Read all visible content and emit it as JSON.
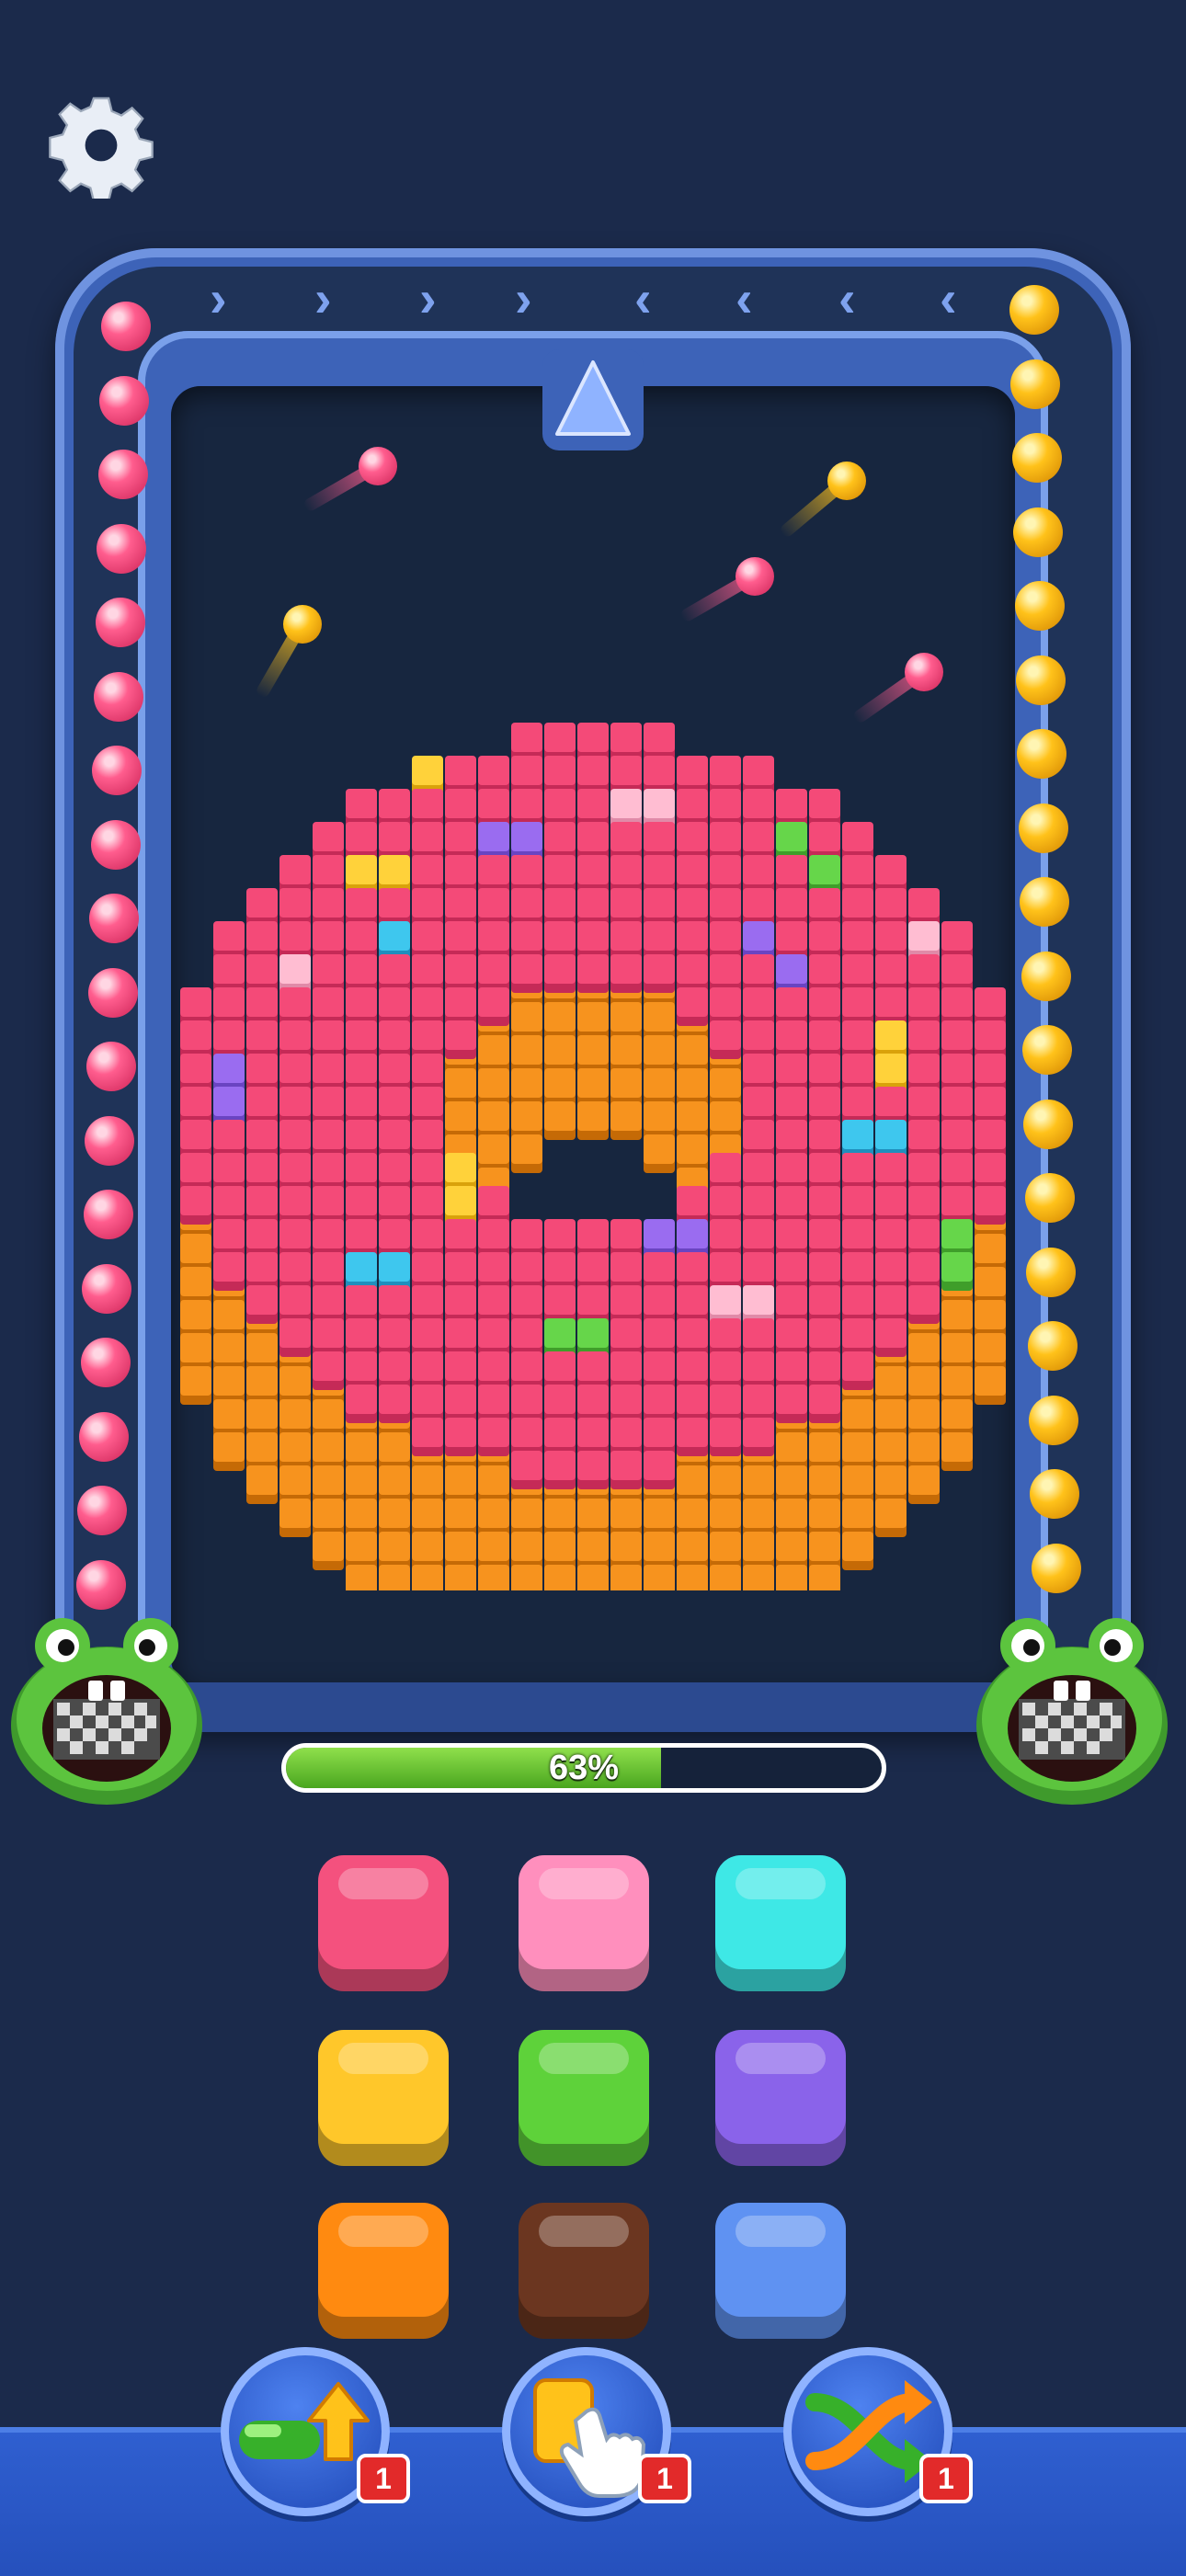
{
  "progress": {
    "value": 63,
    "label": "63%"
  },
  "colors": {
    "background": "#1b2a4b",
    "board_frame": "#3d63b8",
    "ball_pink": "#ff5d8e",
    "ball_gold": "#ffc21a",
    "donut_icing": "#f44a78",
    "donut_dough": "#f7931e",
    "progress_fill": "#6cc63a"
  },
  "conveyor": {
    "left_queue_color": "pink",
    "right_queue_color": "gold",
    "left_count": 18,
    "right_count": 18,
    "launcher_icon": "up-triangle-icon"
  },
  "flying_balls": [
    "pink",
    "gold",
    "pink",
    "gold",
    "pink"
  ],
  "picture": {
    "subject": "donut",
    "colors": [
      "pink",
      "orange",
      "yellow",
      "purple",
      "green",
      "cyan",
      "light-pink"
    ]
  },
  "color_tiles": [
    {
      "name": "pink",
      "color": "#f4517e"
    },
    {
      "name": "light-pink",
      "color": "#ff8fbd"
    },
    {
      "name": "cyan",
      "color": "#3ee8e6"
    },
    {
      "name": "yellow",
      "color": "#ffc72a"
    },
    {
      "name": "green",
      "color": "#5ed23a"
    },
    {
      "name": "purple",
      "color": "#8a63ea"
    },
    {
      "name": "orange",
      "color": "#ff8a10"
    },
    {
      "name": "brown",
      "color": "#6b3620"
    },
    {
      "name": "blue",
      "color": "#5f92f2"
    }
  ],
  "powerups": [
    {
      "id": "boost",
      "icon": "capsule-arrow-up-icon",
      "count": "1"
    },
    {
      "id": "pick",
      "icon": "hand-tap-icon",
      "count": "1"
    },
    {
      "id": "shuffle",
      "icon": "shuffle-icon",
      "count": "1"
    }
  ],
  "icons": {
    "settings": "gear-icon",
    "collector": "frog-mouth-icon"
  }
}
